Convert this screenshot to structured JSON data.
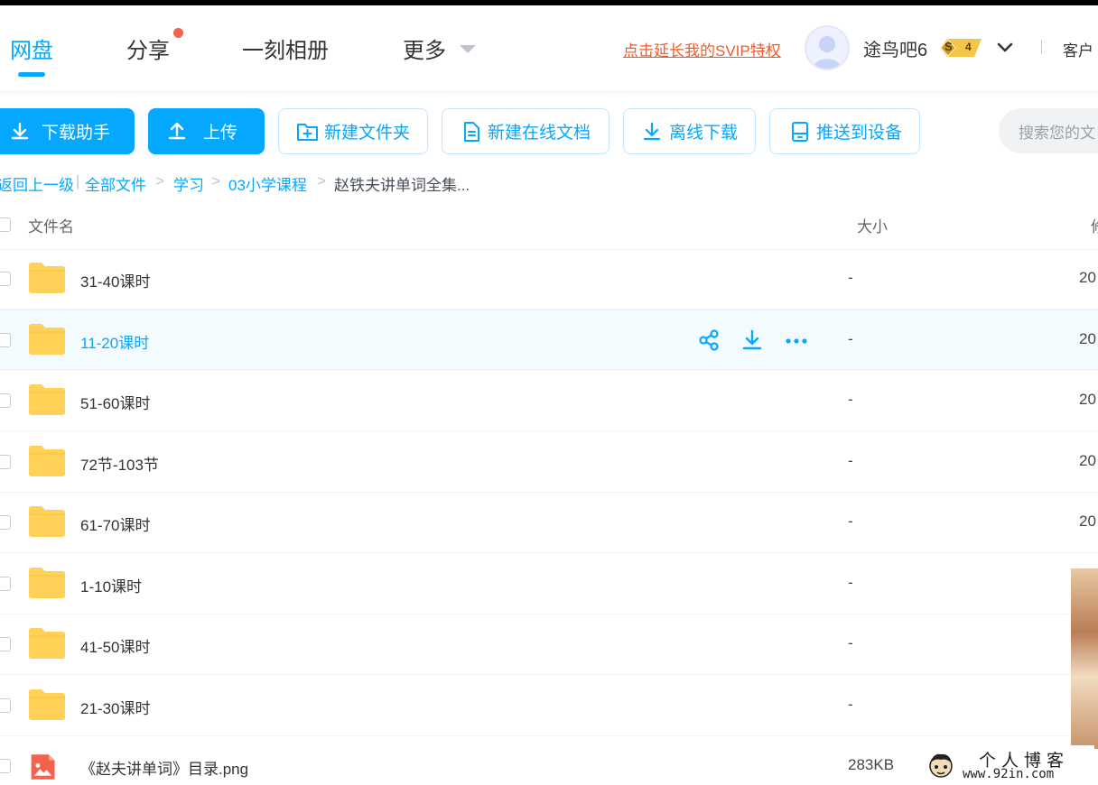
{
  "nav": {
    "tabs": [
      {
        "label": "网盘",
        "active": true
      },
      {
        "label": "分享",
        "has_dot": true
      },
      {
        "label": "一刻相册"
      },
      {
        "label": "更多"
      }
    ]
  },
  "header": {
    "svip_link": "点击延长我的SVIP特权",
    "username": "途鸟吧6",
    "vip_badge": {
      "letter": "S",
      "level": "4"
    },
    "client_label": "客户"
  },
  "toolbar": {
    "download_helper": "下载助手",
    "upload": "上传",
    "new_folder": "新建文件夹",
    "new_doc": "新建在线文档",
    "offline_download": "离线下载",
    "push_device": "推送到设备",
    "search_placeholder": "搜索您的文"
  },
  "breadcrumb": {
    "back": "返回上一级",
    "items": [
      "全部文件",
      "学习",
      "03小学课程"
    ],
    "current": "赵铁夫讲单词全集..."
  },
  "table": {
    "columns": {
      "name": "文件名",
      "size": "大小",
      "modified": "修"
    },
    "rows": [
      {
        "name": "31-40课时",
        "type": "folder",
        "size": "-",
        "date": "20"
      },
      {
        "name": "11-20课时",
        "type": "folder",
        "size": "-",
        "date": "20",
        "hover": true
      },
      {
        "name": "51-60课时",
        "type": "folder",
        "size": "-",
        "date": "20"
      },
      {
        "name": "72节-103节",
        "type": "folder",
        "size": "-",
        "date": "20"
      },
      {
        "name": "61-70课时",
        "type": "folder",
        "size": "-",
        "date": "20"
      },
      {
        "name": "1-10课时",
        "type": "folder",
        "size": "-",
        "date": ""
      },
      {
        "name": "41-50课时",
        "type": "folder",
        "size": "-",
        "date": ""
      },
      {
        "name": "21-30课时",
        "type": "folder",
        "size": "-",
        "date": ""
      },
      {
        "name": "《赵夫讲单词》目录.png",
        "type": "image",
        "size": "283KB",
        "date": ""
      }
    ]
  },
  "watermark": {
    "line1": "个人博客",
    "line2": "www.92in.com"
  },
  "colors": {
    "accent": "#06a7ff",
    "svip": "#f25a29",
    "folder": "#ffd257",
    "dot": "#f4614c"
  }
}
